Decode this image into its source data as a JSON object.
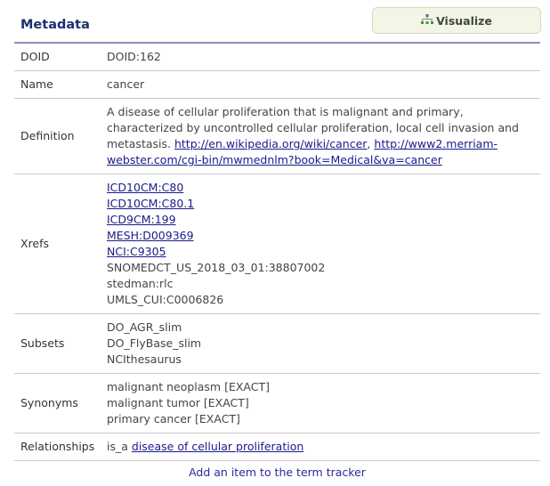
{
  "header": {
    "title": "Metadata",
    "visualize_label": "Visualize"
  },
  "rows": {
    "doid": {
      "label": "DOID",
      "value": "DOID:162"
    },
    "name": {
      "label": "Name",
      "value": "cancer"
    },
    "definition": {
      "label": "Definition",
      "text": "A disease of cellular proliferation that is malignant and primary, characterized by uncontrolled cellular proliferation, local cell invasion and metastasis.",
      "link1": "http://en.wikipedia.org/wiki/cancer",
      "separator": ",",
      "link2": "http://www2.merriam-webster.com/cgi-bin/mwmednlm?book=Medical&va=cancer"
    },
    "xrefs": {
      "label": "Xrefs",
      "links": [
        "ICD10CM:C80",
        "ICD10CM:C80.1",
        "ICD9CM:199",
        "MESH:D009369",
        "NCI:C9305"
      ],
      "plain": [
        "SNOMEDCT_US_2018_03_01:38807002",
        "stedman:rlc",
        "UMLS_CUI:C0006826"
      ]
    },
    "subsets": {
      "label": "Subsets",
      "items": [
        "DO_AGR_slim",
        "DO_FlyBase_slim",
        "NCIthesaurus"
      ]
    },
    "synonyms": {
      "label": "Synonyms",
      "items": [
        "malignant neoplasm [EXACT]",
        "malignant tumor [EXACT]",
        "primary cancer [EXACT]"
      ]
    },
    "relationships": {
      "label": "Relationships",
      "relation": "is_a",
      "target": "disease of cellular proliferation"
    }
  },
  "footer": {
    "tracker_label": "Add an item to the term tracker"
  },
  "colors": {
    "title": "#1f2f6e",
    "link": "#1a1a8c",
    "button_bg": "#f3f5e6",
    "header_rule": "#8a93b8"
  },
  "icons": {
    "visualize": "hierarchy-icon"
  }
}
